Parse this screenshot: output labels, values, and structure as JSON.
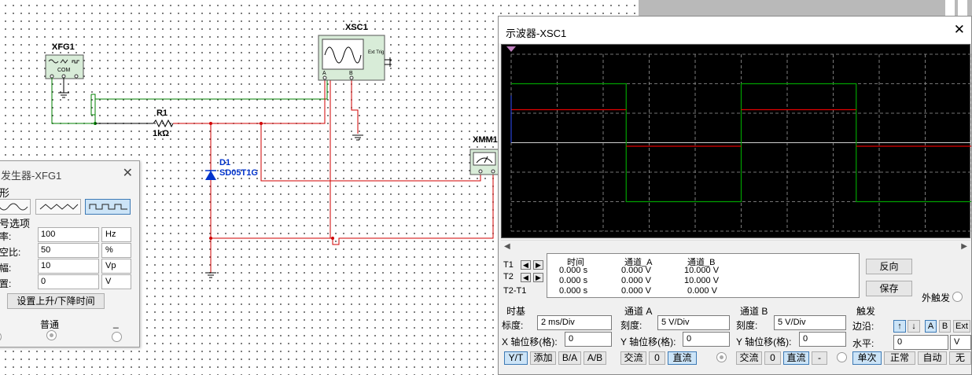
{
  "schematic": {
    "xfg1": {
      "ref": "XFG1",
      "terminals": "COM"
    },
    "xsc1": {
      "ref": "XSC1",
      "ext_trig": "Ext Trig",
      "pin_a": "A",
      "pin_b": "B"
    },
    "r1": {
      "ref": "R1",
      "value": "1kΩ"
    },
    "d1": {
      "ref": "D1",
      "part": "SD05T1G"
    },
    "xmm1": {
      "ref": "XMM1"
    }
  },
  "function_generator": {
    "title": "发生器-XFG1",
    "close": "✕",
    "waveform_section": "形",
    "waveforms": [
      {
        "icon": "sine-wave-icon",
        "selected": false
      },
      {
        "icon": "triangle-wave-icon",
        "selected": false
      },
      {
        "icon": "square-wave-icon",
        "selected": true
      }
    ],
    "options_section": "号选项",
    "rows": [
      {
        "label": "率:",
        "value": "100",
        "unit": "Hz"
      },
      {
        "label": "空比:",
        "value": "50",
        "unit": "%"
      },
      {
        "label": "幅:",
        "value": "10",
        "unit": "Vp"
      },
      {
        "label": "置:",
        "value": "0",
        "unit": "V"
      }
    ],
    "rise_fall_button": "设置上升/下降时间",
    "normal_label": "普通",
    "minus_label": "_"
  },
  "oscilloscope": {
    "title": "示波器-XSC1",
    "close": "✕",
    "readout": {
      "headers": [
        "时间",
        "通道_A",
        "通道_B"
      ],
      "rows": [
        {
          "label": "T1",
          "time": "0.000 s",
          "a": "0.000 V",
          "b": "10.000 V"
        },
        {
          "label": "T2",
          "time": "0.000 s",
          "a": "0.000 V",
          "b": "10.000 V"
        },
        {
          "label": "T2-T1",
          "time": "0.000 s",
          "a": "0.000 V",
          "b": "0.000 V"
        }
      ]
    },
    "reverse_button": "反向",
    "save_button": "保存",
    "ext_trigger_label": "外触发",
    "timebase": {
      "title": "时基",
      "scale_label": "标度:",
      "scale_value": "2 ms/Div",
      "xpos_label": "X 轴位移(格):",
      "xpos_value": "0",
      "buttons": [
        {
          "label": "Y/T",
          "selected": true
        },
        {
          "label": "添加",
          "selected": false
        },
        {
          "label": "B/A",
          "selected": false
        },
        {
          "label": "A/B",
          "selected": false
        }
      ]
    },
    "channel_a": {
      "title": "通道 A",
      "scale_label": "刻度:",
      "scale_value": "5  V/Div",
      "ypos_label": "Y 轴位移(格):",
      "ypos_value": "0",
      "buttons": [
        {
          "label": "交流",
          "selected": false
        },
        {
          "label": "0",
          "selected": false
        },
        {
          "label": "直流",
          "selected": true
        }
      ]
    },
    "channel_b": {
      "title": "通道 B",
      "scale_label": "刻度:",
      "scale_value": "5  V/Div",
      "ypos_label": "Y 轴位移(格):",
      "ypos_value": "0",
      "buttons": [
        {
          "label": "交流",
          "selected": false
        },
        {
          "label": "0",
          "selected": false
        },
        {
          "label": "直流",
          "selected": true
        },
        {
          "label": "-",
          "selected": false
        }
      ]
    },
    "trigger": {
      "title": "触发",
      "edge_label": "边沿:",
      "edge_buttons": [
        {
          "label": "↑",
          "selected": true
        },
        {
          "label": "↓",
          "selected": false
        },
        {
          "label": "A",
          "selected": true
        },
        {
          "label": "B",
          "selected": false
        },
        {
          "label": "Ext",
          "selected": false
        }
      ],
      "level_label": "水平:",
      "level_value": "0",
      "level_unit": "V",
      "mode_buttons": [
        {
          "label": "单次",
          "selected": true
        },
        {
          "label": "正常",
          "selected": false
        },
        {
          "label": "自动",
          "selected": false
        },
        {
          "label": "无",
          "selected": false
        }
      ]
    },
    "traces": {
      "channel_a_color": "#e00000",
      "channel_b_color": "#00a000",
      "time_per_div_ms": 2,
      "volts_per_div": 5,
      "channel_b_levels_v": [
        10,
        -10
      ],
      "channel_a_levels_v": [
        5.6,
        -0.6
      ],
      "period_ms": 10
    }
  },
  "colors": {
    "wire_red": "#d00000",
    "wire_green": "#008000",
    "selected_blue": "#cce4f7",
    "diode_blue": "#0033cc"
  }
}
